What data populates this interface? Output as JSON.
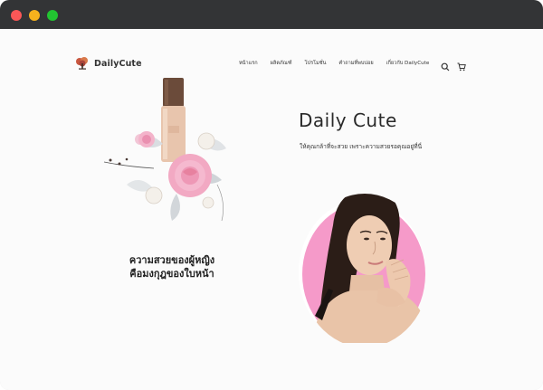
{
  "window": {
    "controls": [
      "close",
      "minimize",
      "maximize"
    ]
  },
  "brand": {
    "name": "DailyCute",
    "logo_icon": "tree-logo-icon"
  },
  "nav": {
    "items": [
      {
        "label": "หน้าแรก"
      },
      {
        "label": "ผลิตภัณฑ์"
      },
      {
        "label": "โปรโมชั่น"
      },
      {
        "label": "คำถามที่พบบ่อย"
      },
      {
        "label": "เกี่ยวกับ DailyCute"
      }
    ],
    "icons": [
      "search-icon",
      "cart-icon"
    ]
  },
  "hero": {
    "title": "Daily Cute",
    "subtitle": "ให้คุณกล้าที่จะสวย เพราะความสวยรอคุณอยู่ที่นี่",
    "tagline_line1": "ความสวยของผู้หญิง",
    "tagline_line2": "คือมงกุฎของใบหน้า"
  },
  "colors": {
    "titlebar": "#333436",
    "accent_pink": "#f59ac9",
    "text": "#2a2a2a"
  }
}
